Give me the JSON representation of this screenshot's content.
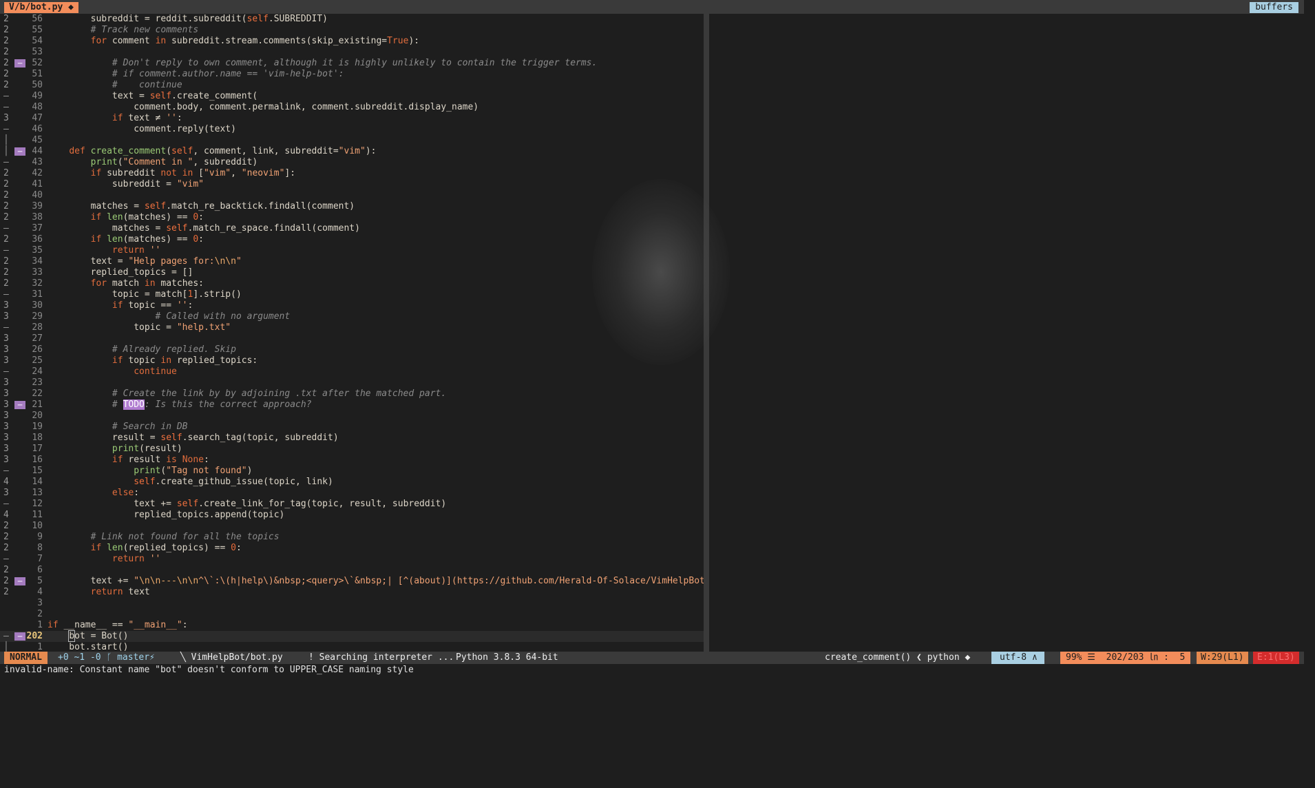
{
  "tabline": {
    "current_tab": "V/b/bot.py ◆",
    "buffers_label": "buffers"
  },
  "editor": {
    "lines": [
      {
        "count": "2",
        "sign": "",
        "num": "56",
        "tokens": [
          {
            "t": "        subreddit = reddit.subreddit("
          },
          {
            "t": "self",
            "c": "self"
          },
          {
            "t": ".SUBREDDIT)"
          }
        ]
      },
      {
        "count": "2",
        "sign": "",
        "num": "55",
        "tokens": [
          {
            "t": "        "
          },
          {
            "t": "# Track new comments",
            "c": "cm"
          }
        ]
      },
      {
        "count": "2",
        "sign": "",
        "num": "54",
        "tokens": [
          {
            "t": "        "
          },
          {
            "t": "for",
            "c": "kw"
          },
          {
            "t": " comment "
          },
          {
            "t": "in",
            "c": "kw"
          },
          {
            "t": " subreddit.stream.comments(skip_existing="
          },
          {
            "t": "True",
            "c": "kw"
          },
          {
            "t": "):"
          }
        ]
      },
      {
        "count": "2",
        "sign": "",
        "num": "53",
        "tokens": []
      },
      {
        "count": "2",
        "sign": "—",
        "num": "52",
        "tokens": [
          {
            "t": "            "
          },
          {
            "t": "# Don't reply to own comment, although it is highly unlikely to contain the trigger terms.",
            "c": "cm"
          }
        ]
      },
      {
        "count": "2",
        "sign": "",
        "num": "51",
        "tokens": [
          {
            "t": "            "
          },
          {
            "t": "# if comment.author.name == 'vim-help-bot':",
            "c": "cm"
          }
        ]
      },
      {
        "count": "2",
        "sign": "",
        "num": "50",
        "tokens": [
          {
            "t": "            "
          },
          {
            "t": "#    continue",
            "c": "cm"
          }
        ]
      },
      {
        "count": "–",
        "sign": "",
        "num": "49",
        "tokens": [
          {
            "t": "            text = "
          },
          {
            "t": "self",
            "c": "self"
          },
          {
            "t": ".create_comment("
          }
        ]
      },
      {
        "count": "–",
        "sign": "",
        "num": "48",
        "tokens": [
          {
            "t": "                comment.body, comment.permalink, comment.subreddit.display_name)"
          }
        ]
      },
      {
        "count": "3",
        "sign": "",
        "num": "47",
        "tokens": [
          {
            "t": "            "
          },
          {
            "t": "if",
            "c": "kw"
          },
          {
            "t": " text ≠ "
          },
          {
            "t": "''",
            "c": "str"
          },
          {
            "t": ":"
          }
        ]
      },
      {
        "count": "–",
        "sign": "",
        "num": "46",
        "tokens": [
          {
            "t": "                comment.reply(text)"
          }
        ]
      },
      {
        "count": "│",
        "sign": "",
        "num": "45",
        "tokens": []
      },
      {
        "count": "│",
        "sign": "—",
        "num": "44",
        "tokens": [
          {
            "t": "    "
          },
          {
            "t": "def",
            "c": "kw"
          },
          {
            "t": " "
          },
          {
            "t": "create_comment",
            "c": "fn"
          },
          {
            "t": "("
          },
          {
            "t": "self",
            "c": "self"
          },
          {
            "t": ", comment, link, subreddit="
          },
          {
            "t": "\"vim\"",
            "c": "str"
          },
          {
            "t": "):"
          }
        ]
      },
      {
        "count": "–",
        "sign": "",
        "num": "43",
        "tokens": [
          {
            "t": "        "
          },
          {
            "t": "print",
            "c": "fn"
          },
          {
            "t": "("
          },
          {
            "t": "\"Comment in \"",
            "c": "str"
          },
          {
            "t": ", subreddit)"
          }
        ]
      },
      {
        "count": "2",
        "sign": "",
        "num": "42",
        "tokens": [
          {
            "t": "        "
          },
          {
            "t": "if",
            "c": "kw"
          },
          {
            "t": " subreddit "
          },
          {
            "t": "not in",
            "c": "kw"
          },
          {
            "t": " ["
          },
          {
            "t": "\"vim\"",
            "c": "str"
          },
          {
            "t": ", "
          },
          {
            "t": "\"neovim\"",
            "c": "str"
          },
          {
            "t": "]:"
          }
        ]
      },
      {
        "count": "2",
        "sign": "",
        "num": "41",
        "tokens": [
          {
            "t": "            subreddit = "
          },
          {
            "t": "\"vim\"",
            "c": "str"
          }
        ]
      },
      {
        "count": "2",
        "sign": "",
        "num": "40",
        "tokens": []
      },
      {
        "count": "2",
        "sign": "",
        "num": "39",
        "tokens": [
          {
            "t": "        matches = "
          },
          {
            "t": "self",
            "c": "self"
          },
          {
            "t": ".match_re_backtick.findall(comment)"
          }
        ]
      },
      {
        "count": "2",
        "sign": "",
        "num": "38",
        "tokens": [
          {
            "t": "        "
          },
          {
            "t": "if",
            "c": "kw"
          },
          {
            "t": " "
          },
          {
            "t": "len",
            "c": "fn"
          },
          {
            "t": "(matches) == "
          },
          {
            "t": "0",
            "c": "num"
          },
          {
            "t": ":"
          }
        ]
      },
      {
        "count": "–",
        "sign": "",
        "num": "37",
        "tokens": [
          {
            "t": "            matches = "
          },
          {
            "t": "self",
            "c": "self"
          },
          {
            "t": ".match_re_space.findall(comment)"
          }
        ]
      },
      {
        "count": "2",
        "sign": "",
        "num": "36",
        "tokens": [
          {
            "t": "        "
          },
          {
            "t": "if",
            "c": "kw"
          },
          {
            "t": " "
          },
          {
            "t": "len",
            "c": "fn"
          },
          {
            "t": "(matches) == "
          },
          {
            "t": "0",
            "c": "num"
          },
          {
            "t": ":"
          }
        ]
      },
      {
        "count": "–",
        "sign": "",
        "num": "35",
        "tokens": [
          {
            "t": "            "
          },
          {
            "t": "return",
            "c": "kw"
          },
          {
            "t": " "
          },
          {
            "t": "''",
            "c": "str"
          }
        ]
      },
      {
        "count": "2",
        "sign": "",
        "num": "34",
        "tokens": [
          {
            "t": "        text = "
          },
          {
            "t": "\"Help pages for:",
            "c": "str"
          },
          {
            "t": "\\n\\n",
            "c": "esc"
          },
          {
            "t": "\"",
            "c": "str"
          }
        ]
      },
      {
        "count": "2",
        "sign": "",
        "num": "33",
        "tokens": [
          {
            "t": "        replied_topics = []"
          }
        ]
      },
      {
        "count": "2",
        "sign": "",
        "num": "32",
        "tokens": [
          {
            "t": "        "
          },
          {
            "t": "for",
            "c": "kw"
          },
          {
            "t": " match "
          },
          {
            "t": "in",
            "c": "kw"
          },
          {
            "t": " matches:"
          }
        ]
      },
      {
        "count": "–",
        "sign": "",
        "num": "31",
        "tokens": [
          {
            "t": "            topic = match["
          },
          {
            "t": "1",
            "c": "num"
          },
          {
            "t": "].strip()"
          }
        ]
      },
      {
        "count": "3",
        "sign": "",
        "num": "30",
        "tokens": [
          {
            "t": "            "
          },
          {
            "t": "if",
            "c": "kw"
          },
          {
            "t": " topic == "
          },
          {
            "t": "''",
            "c": "str"
          },
          {
            "t": ":"
          }
        ]
      },
      {
        "count": "3",
        "sign": "",
        "num": "29",
        "tokens": [
          {
            "t": "                    "
          },
          {
            "t": "# Called with no argument",
            "c": "cm"
          }
        ]
      },
      {
        "count": "–",
        "sign": "",
        "num": "28",
        "tokens": [
          {
            "t": "                topic = "
          },
          {
            "t": "\"help.txt\"",
            "c": "str"
          }
        ]
      },
      {
        "count": "3",
        "sign": "",
        "num": "27",
        "tokens": []
      },
      {
        "count": "3",
        "sign": "",
        "num": "26",
        "tokens": [
          {
            "t": "            "
          },
          {
            "t": "# Already replied. Skip",
            "c": "cm"
          }
        ]
      },
      {
        "count": "3",
        "sign": "",
        "num": "25",
        "tokens": [
          {
            "t": "            "
          },
          {
            "t": "if",
            "c": "kw"
          },
          {
            "t": " topic "
          },
          {
            "t": "in",
            "c": "kw"
          },
          {
            "t": " replied_topics:"
          }
        ]
      },
      {
        "count": "–",
        "sign": "",
        "num": "24",
        "tokens": [
          {
            "t": "                "
          },
          {
            "t": "continue",
            "c": "kw"
          }
        ]
      },
      {
        "count": "3",
        "sign": "",
        "num": "23",
        "tokens": []
      },
      {
        "count": "3",
        "sign": "",
        "num": "22",
        "tokens": [
          {
            "t": "            "
          },
          {
            "t": "# Create the link by by adjoining .txt after the matched part.",
            "c": "cm"
          }
        ]
      },
      {
        "count": "3",
        "sign": "—",
        "num": "21",
        "tokens": [
          {
            "t": "            "
          },
          {
            "t": "# ",
            "c": "cm"
          },
          {
            "t": "TODO",
            "c": "todo"
          },
          {
            "t": ": Is this the correct approach?",
            "c": "cm"
          }
        ]
      },
      {
        "count": "3",
        "sign": "",
        "num": "20",
        "tokens": []
      },
      {
        "count": "3",
        "sign": "",
        "num": "19",
        "tokens": [
          {
            "t": "            "
          },
          {
            "t": "# Search in DB",
            "c": "cm"
          }
        ]
      },
      {
        "count": "3",
        "sign": "",
        "num": "18",
        "tokens": [
          {
            "t": "            result = "
          },
          {
            "t": "self",
            "c": "self"
          },
          {
            "t": ".search_tag(topic, subreddit)"
          }
        ]
      },
      {
        "count": "3",
        "sign": "",
        "num": "17",
        "tokens": [
          {
            "t": "            "
          },
          {
            "t": "print",
            "c": "fn"
          },
          {
            "t": "(result)"
          }
        ]
      },
      {
        "count": "3",
        "sign": "",
        "num": "16",
        "tokens": [
          {
            "t": "            "
          },
          {
            "t": "if",
            "c": "kw"
          },
          {
            "t": " result "
          },
          {
            "t": "is",
            "c": "kw"
          },
          {
            "t": " "
          },
          {
            "t": "None",
            "c": "kw"
          },
          {
            "t": ":"
          }
        ]
      },
      {
        "count": "–",
        "sign": "",
        "num": "15",
        "tokens": [
          {
            "t": "                "
          },
          {
            "t": "print",
            "c": "fn"
          },
          {
            "t": "("
          },
          {
            "t": "\"Tag not found\"",
            "c": "str"
          },
          {
            "t": ")"
          }
        ]
      },
      {
        "count": "4",
        "sign": "",
        "num": "14",
        "tokens": [
          {
            "t": "                "
          },
          {
            "t": "self",
            "c": "self"
          },
          {
            "t": ".create_github_issue(topic, link)"
          }
        ]
      },
      {
        "count": "3",
        "sign": "",
        "num": "13",
        "tokens": [
          {
            "t": "            "
          },
          {
            "t": "else",
            "c": "kw"
          },
          {
            "t": ":"
          }
        ]
      },
      {
        "count": "–",
        "sign": "",
        "num": "12",
        "tokens": [
          {
            "t": "                text += "
          },
          {
            "t": "self",
            "c": "self"
          },
          {
            "t": ".create_link_for_tag(topic, result, subreddit)"
          }
        ]
      },
      {
        "count": "4",
        "sign": "",
        "num": "11",
        "tokens": [
          {
            "t": "                replied_topics.append(topic)"
          }
        ]
      },
      {
        "count": "2",
        "sign": "",
        "num": "10",
        "tokens": []
      },
      {
        "count": "2",
        "sign": "",
        "num": "9",
        "tokens": [
          {
            "t": "        "
          },
          {
            "t": "# Link not found for all the topics",
            "c": "cm"
          }
        ]
      },
      {
        "count": "2",
        "sign": "",
        "num": "8",
        "tokens": [
          {
            "t": "        "
          },
          {
            "t": "if",
            "c": "kw"
          },
          {
            "t": " "
          },
          {
            "t": "len",
            "c": "fn"
          },
          {
            "t": "(replied_topics) == "
          },
          {
            "t": "0",
            "c": "num"
          },
          {
            "t": ":"
          }
        ]
      },
      {
        "count": "–",
        "sign": "",
        "num": "7",
        "tokens": [
          {
            "t": "            "
          },
          {
            "t": "return",
            "c": "kw"
          },
          {
            "t": " "
          },
          {
            "t": "''",
            "c": "str"
          }
        ]
      },
      {
        "count": "2",
        "sign": "",
        "num": "6",
        "tokens": []
      },
      {
        "count": "2",
        "sign": "—",
        "num": "5",
        "tokens": [
          {
            "t": "        text += "
          },
          {
            "t": "\"",
            "c": "str"
          },
          {
            "t": "\\n\\n---\\n\\n",
            "c": "esc"
          },
          {
            "t": "^\\`:\\(h|help\\)&nbsp;<query>\\`&nbsp;| [^(about)](https://github.com/Herald-Of-Solace/VimHelpBot) ^(|) [^(mistake?)](https://github.com/Herald-Of-Solace/VimHelpBot/issues/new/choose)\"",
            "c": "str"
          }
        ]
      },
      {
        "count": "2",
        "sign": "",
        "num": "4",
        "tokens": [
          {
            "t": "        "
          },
          {
            "t": "return",
            "c": "kw"
          },
          {
            "t": " text"
          }
        ]
      },
      {
        "count": "",
        "sign": "",
        "num": "3",
        "tokens": []
      },
      {
        "count": "",
        "sign": "",
        "num": "2",
        "tokens": []
      },
      {
        "count": "",
        "sign": "",
        "num": "1",
        "tokens": [
          {
            "t": "if",
            "c": "kw"
          },
          {
            "t": " __name__ == "
          },
          {
            "t": "\"__main__\"",
            "c": "str"
          },
          {
            "t": ":"
          }
        ]
      },
      {
        "count": "–",
        "sign": "—",
        "num": "202",
        "current": true,
        "tokens": [
          {
            "t": "    "
          },
          {
            "t": "b",
            "c": "cursor"
          },
          {
            "t": "ot = Bot()"
          }
        ]
      },
      {
        "count": "│",
        "sign": "",
        "num": "1",
        "tokens": [
          {
            "t": "    bot.start()"
          }
        ]
      }
    ]
  },
  "statusline": {
    "mode": "NORMAL",
    "git": "+0 ~1 -0 ᚴ master⚡",
    "file": "╲ VimHelpBot/bot.py",
    "lint": "! Searching interpreter ...",
    "interpreter": "Python 3.8.3 64-bit",
    "function": "create_comment() ❮ python ◆",
    "encoding": "utf-8 ∧",
    "position": "99% ☰  202/203 ㏑ :  5",
    "warnings": "W:29(L1)",
    "errors": "E:1(L3)"
  },
  "cmdline": {
    "message": "invalid-name: Constant name \"bot\" doesn't conform to UPPER_CASE naming style"
  }
}
